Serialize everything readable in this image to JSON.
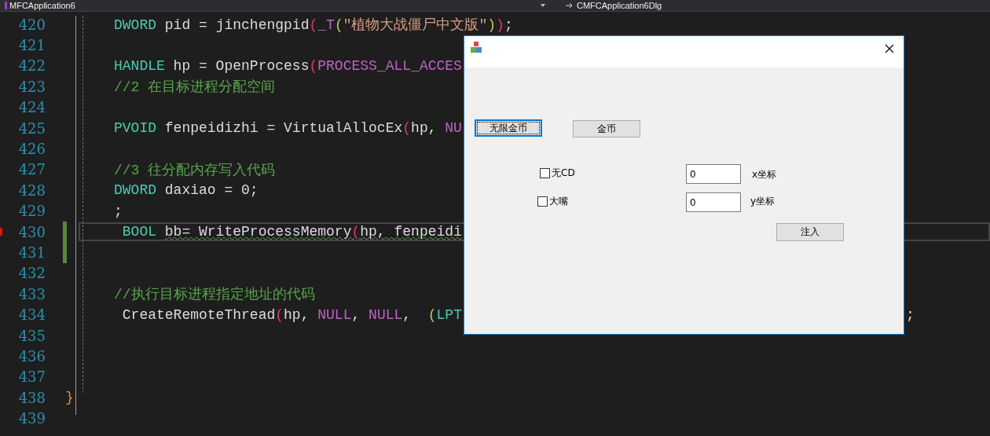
{
  "editor": {
    "file_dropdown": "MFCApplication6",
    "class_dropdown": "CMFCApplication6Dlg",
    "lines": [
      {
        "number": "420",
        "selected": false,
        "modified": false,
        "tokens": [
          {
            "kind": "type",
            "text": "DWORD"
          },
          {
            "kind": "plain",
            "text": " pid = jinchengpid"
          },
          {
            "kind": "paren1",
            "text": "("
          },
          {
            "kind": "macro",
            "text": "_T"
          },
          {
            "kind": "paren2",
            "text": "("
          },
          {
            "kind": "string",
            "text": "\"植物大战僵尸中文版\""
          },
          {
            "kind": "paren2",
            "text": ")"
          },
          {
            "kind": "paren1",
            "text": ")"
          },
          {
            "kind": "plain",
            "text": ";"
          }
        ]
      },
      {
        "number": "421",
        "selected": false,
        "modified": false
      },
      {
        "number": "422",
        "selected": false,
        "modified": false,
        "tokens": [
          {
            "kind": "type",
            "text": "HANDLE"
          },
          {
            "kind": "plain",
            "text": " hp = OpenProcess"
          },
          {
            "kind": "paren1",
            "text": "("
          },
          {
            "kind": "macro",
            "text": "PROCESS_ALL_ACCES"
          }
        ]
      },
      {
        "number": "423",
        "selected": false,
        "modified": false,
        "tokens": [
          {
            "kind": "comment",
            "text": "//2 在目标进程分配空间"
          }
        ]
      },
      {
        "number": "424",
        "selected": false,
        "modified": false
      },
      {
        "number": "425",
        "selected": false,
        "modified": false,
        "tokens": [
          {
            "kind": "type",
            "text": "PVOID"
          },
          {
            "kind": "plain",
            "text": " fenpeidizhi = VirtualAllocEx"
          },
          {
            "kind": "paren1",
            "text": "("
          },
          {
            "kind": "plain",
            "text": "hp, "
          },
          {
            "kind": "macro",
            "text": "NU"
          }
        ]
      },
      {
        "number": "426",
        "selected": false,
        "modified": false
      },
      {
        "number": "427",
        "selected": false,
        "modified": false,
        "tokens": [
          {
            "kind": "comment",
            "text": "//3 往分配内存写入代码"
          }
        ]
      },
      {
        "number": "428",
        "selected": false,
        "modified": false,
        "tokens": [
          {
            "kind": "type",
            "text": "DWORD"
          },
          {
            "kind": "plain",
            "text": " daxiao = 0;"
          }
        ]
      },
      {
        "number": "429",
        "selected": false,
        "modified": false,
        "tokens": [
          {
            "kind": "plain",
            "text": ";"
          }
        ]
      },
      {
        "number": "430",
        "selected": true,
        "modified": true,
        "tokens": [
          {
            "kind": "type",
            "text": " BOOL "
          },
          {
            "kind": "plain",
            "text": "bb= WriteProcessMemory",
            "underlined": true
          },
          {
            "kind": "paren1",
            "text": "(",
            "underlined": true
          },
          {
            "kind": "plain",
            "text": "hp, fenpeidi",
            "underlined": true
          }
        ]
      },
      {
        "number": "431",
        "selected": false,
        "modified": true
      },
      {
        "number": "432",
        "selected": false,
        "modified": false
      },
      {
        "number": "433",
        "selected": false,
        "modified": false,
        "tokens": [
          {
            "kind": "comment",
            "text": "//执行目标进程指定地址的代码"
          }
        ]
      },
      {
        "number": "434",
        "selected": false,
        "modified": false,
        "tokens": [
          {
            "kind": "plain",
            "text": " CreateRemoteThread"
          },
          {
            "kind": "paren1",
            "text": "("
          },
          {
            "kind": "plain",
            "text": "hp, "
          },
          {
            "kind": "macro",
            "text": "NULL"
          },
          {
            "kind": "plain",
            "text": ", "
          },
          {
            "kind": "macro",
            "text": "NULL"
          },
          {
            "kind": "plain",
            "text": ",  "
          },
          {
            "kind": "paren2",
            "text": "("
          },
          {
            "kind": "type",
            "text": "LPT"
          }
        ],
        "tail": ";"
      },
      {
        "number": "435",
        "selected": false,
        "modified": false
      },
      {
        "number": "436",
        "selected": false,
        "modified": false
      },
      {
        "number": "437",
        "selected": false,
        "modified": false
      },
      {
        "number": "438",
        "selected": false,
        "modified": false,
        "tokens": [
          {
            "kind": "brace",
            "text": "}"
          }
        ]
      },
      {
        "number": "439",
        "selected": false,
        "modified": false
      }
    ]
  },
  "dialog": {
    "buttons": [
      {
        "label": "无限金币",
        "focused": true
      },
      {
        "label": "金币",
        "focused": false
      },
      {
        "label": "注入",
        "focused": false
      }
    ],
    "checkboxes": [
      {
        "label": "无CD",
        "checked": false
      },
      {
        "label": "大嘴",
        "checked": false
      }
    ],
    "fields": [
      {
        "value": "0",
        "label": "x坐标"
      },
      {
        "value": "0",
        "label": "y坐标"
      }
    ]
  }
}
